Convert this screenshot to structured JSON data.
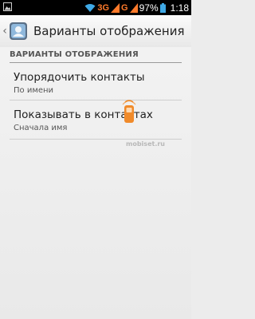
{
  "status_bar": {
    "network": "3G",
    "network_secondary": "G",
    "battery": "97%",
    "time": "1:18",
    "accent_color": "#ff7a2a"
  },
  "action_bar": {
    "title": "Варианты отображения",
    "up_icon": "chevron-left-icon",
    "app_icon": "contacts-app-icon"
  },
  "section": {
    "header": "ВАРИАНТЫ ОТОБРАЖЕНИЯ"
  },
  "items": [
    {
      "title": "Упорядочить контакты",
      "summary": "По имени"
    },
    {
      "title": "Показывать в контактах",
      "summary": "Сначала имя"
    }
  ],
  "watermark": {
    "text": "mobiset.ru"
  }
}
